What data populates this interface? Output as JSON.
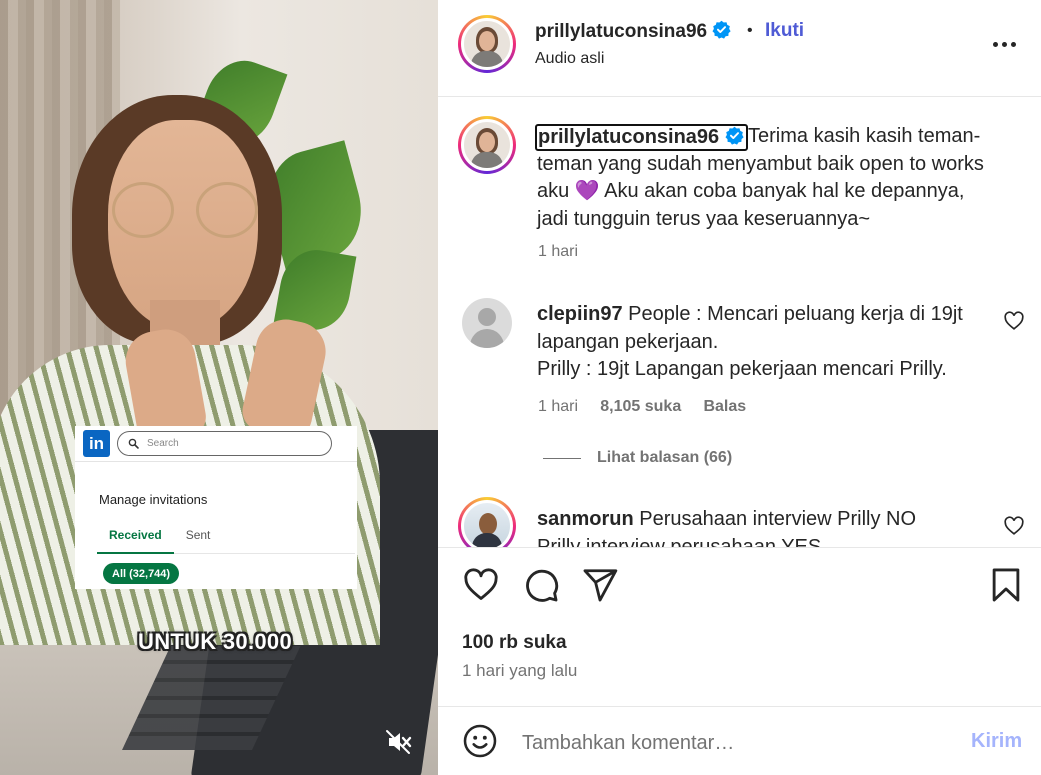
{
  "video": {
    "linkedin": {
      "logo_text": "in",
      "search_placeholder": "Search",
      "manage_label": "Manage invitations",
      "tabs": [
        {
          "label": "Received",
          "active": true
        },
        {
          "label": "Sent",
          "active": false
        }
      ],
      "filter_pill": "All (32,744)"
    },
    "caption": "UNTUK 30.000",
    "mute_icon": "speaker-muted-icon"
  },
  "header": {
    "username": "prillylatuconsina96",
    "verified": true,
    "separator": "•",
    "follow_label": "Ikuti",
    "audio_label": "Audio asli",
    "more_icon": "more-horizontal-icon"
  },
  "caption_post": {
    "username": "prillylatuconsina96",
    "text": "Terima kasih kasih teman-teman yang sudah menyambut baik open to works aku 💜  Aku akan coba banyak hal ke depannya, jadi tungguin terus yaa keseruannya~",
    "time": "1 hari"
  },
  "comments": [
    {
      "username": "clepiin97",
      "line1": "People : Mencari peluang kerja di 19jt lapangan pekerjaan.",
      "line2": "Prilly : 19jt Lapangan pekerjaan mencari Prilly.",
      "time": "1 hari",
      "likes": "8,105 suka",
      "reply_label": "Balas",
      "view_replies": "Lihat balasan (66)"
    },
    {
      "username": "sanmorun",
      "line1": "Perusahaan interview Prilly NO",
      "line2": "Prilly interview perusahaan YES"
    }
  ],
  "actions": {
    "like_icon": "heart-icon",
    "comment_icon": "comment-bubble-icon",
    "share_icon": "paper-plane-icon",
    "save_icon": "bookmark-icon"
  },
  "stats": {
    "likes": "100 rb suka",
    "posted": "1 hari yang lalu"
  },
  "composer": {
    "emoji_icon": "smiley-icon",
    "placeholder": "Tambahkan komentar…",
    "post_label": "Kirim"
  },
  "colors": {
    "follow": "#4f5bd5",
    "verified": "#0095f6",
    "post_disabled": "#a5b4fc",
    "linkedin_blue": "#0a66c2",
    "linkedin_green": "#057642"
  }
}
